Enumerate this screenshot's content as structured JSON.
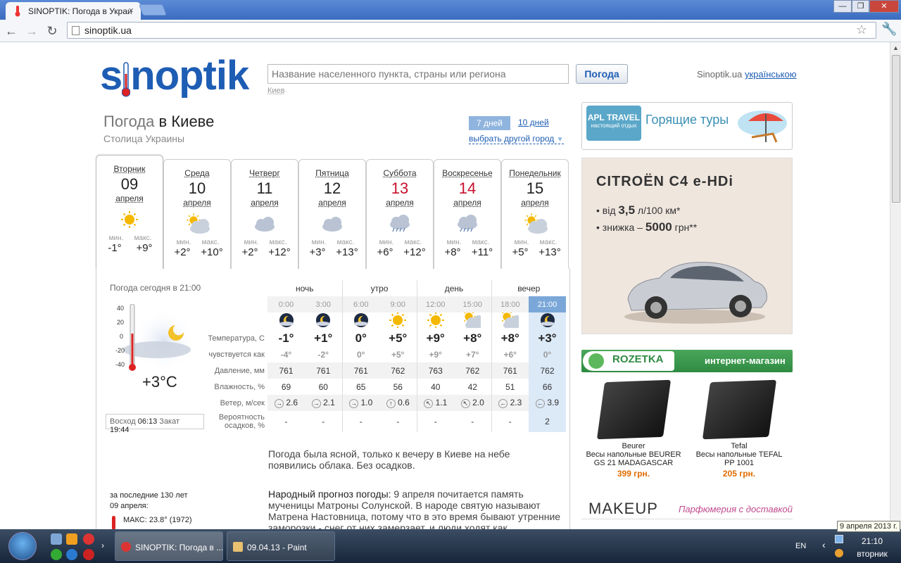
{
  "browser": {
    "tab_title": "SINOPTIK: Погода в Украи",
    "tab_close": "×",
    "url": "sinoptik.ua",
    "win_min": "—",
    "win_max": "❐",
    "win_close": "✕"
  },
  "header": {
    "logo": "sinoptik",
    "search_placeholder": "Название населенного пункта, страны или региона",
    "search_button": "Погода",
    "hint": "Киев",
    "lang_prefix": "Sinoptik.ua",
    "lang_link": "українською"
  },
  "city": {
    "prefix": "Погода",
    "name": "в Киеве",
    "subtitle": "Столица Украины",
    "btn_7": "7 дней",
    "btn_10": "10 дней",
    "other_city": "выбрать другой город"
  },
  "days": [
    {
      "name": "Вторник",
      "date": "09",
      "month": "апреля",
      "min_label": "мин.",
      "max_label": "макс.",
      "min": "-1°",
      "max": "+9°",
      "icon": "sun-icon"
    },
    {
      "name": "Среда",
      "date": "10",
      "month": "апреля",
      "min_label": "мин.",
      "max_label": "макс.",
      "min": "+2°",
      "max": "+10°",
      "icon": "cloud-sun-icon"
    },
    {
      "name": "Четверг",
      "date": "11",
      "month": "апреля",
      "min_label": "мин.",
      "max_label": "макс.",
      "min": "+2°",
      "max": "+12°",
      "icon": "cloud-icon"
    },
    {
      "name": "Пятница",
      "date": "12",
      "month": "апреля",
      "min_label": "мин.",
      "max_label": "макс.",
      "min": "+3°",
      "max": "+13°",
      "icon": "cloud-icon"
    },
    {
      "name": "Суббота",
      "date": "13",
      "month": "апреля",
      "min_label": "мин.",
      "max_label": "макс.",
      "min": "+6°",
      "max": "+12°",
      "icon": "rain-cloud-icon"
    },
    {
      "name": "Воскресенье",
      "date": "14",
      "month": "апреля",
      "min_label": "мин.",
      "max_label": "макс.",
      "min": "+8°",
      "max": "+11°",
      "icon": "rain-cloud-icon"
    },
    {
      "name": "Понедельник",
      "date": "15",
      "month": "апреля",
      "min_label": "мин.",
      "max_label": "макс.",
      "min": "+5°",
      "max": "+13°",
      "icon": "cloud-sun-icon"
    }
  ],
  "now": {
    "label": "Погода сегодня в 21:00",
    "temp": "+3°C",
    "scale": [
      "40",
      "20",
      "0",
      "-20",
      "-40"
    ],
    "sunrise_label": "Восход",
    "sunrise": "06:13",
    "sunset_label": "Закат",
    "sunset": "19:44"
  },
  "hourly": {
    "periods": [
      "ночь",
      "утро",
      "день",
      "вечер"
    ],
    "hours": [
      "0:00",
      "3:00",
      "6:00",
      "9:00",
      "12:00",
      "15:00",
      "18:00",
      "21:00"
    ],
    "icons": [
      "moon-cloud-icon",
      "moon-cloud-icon",
      "moon-cloud-icon",
      "sun-icon",
      "sun-icon",
      "sun-cloud-icon",
      "cloud-sun-icon",
      "moon-cloud-icon"
    ],
    "rows": [
      {
        "label": "Температура, С",
        "values": [
          "-1°",
          "+1°",
          "0°",
          "+5°",
          "+9°",
          "+8°",
          "+8°",
          "+3°"
        ]
      },
      {
        "label": "чувствуется как",
        "values": [
          "-4°",
          "-2°",
          "0°",
          "+5°",
          "+9°",
          "+7°",
          "+6°",
          "0°"
        ]
      },
      {
        "label": "Давление, мм",
        "values": [
          "761",
          "761",
          "761",
          "762",
          "763",
          "762",
          "761",
          "762"
        ]
      },
      {
        "label": "Влажность, %",
        "values": [
          "69",
          "60",
          "65",
          "56",
          "40",
          "42",
          "51",
          "66"
        ]
      },
      {
        "label": "Ветер, м/сек",
        "values": [
          "2.6",
          "2.1",
          "1.0",
          "0.6",
          "1.1",
          "2.0",
          "2.3",
          "3.9"
        ],
        "arrows": [
          "→",
          "→",
          "→",
          "↑",
          "↖",
          "↖",
          "←",
          "←"
        ]
      },
      {
        "label": "Вероятность осадков, %",
        "values": [
          "-",
          "-",
          "-",
          "-",
          "-",
          "-",
          "-",
          "2"
        ]
      }
    ]
  },
  "description": "Погода была ясной, только к вечеру в Киеве на небе появились облака. Без осадков.",
  "folk": {
    "title": "Народный прогноз погоды:",
    "text": " 9 апреля почитается память мученицы Матроны Солунской. В народе святую называют Матрена Настовница, потому что в это время бывают утренние заморозки - снег от них замерзает, и люди ходят как"
  },
  "history": {
    "title": "за последние 130 лет",
    "date": "09 апреля:",
    "max_label": "МАКС:",
    "max": "23.8°",
    "max_year": "(1972)"
  },
  "ads": {
    "tours_logo": "APL TRAVEL",
    "tours_sub": "настоящий отдых",
    "tours_text": "Горящие туры",
    "citroen_title": "CITROËN C4 e-HDi",
    "citroen_l1_pre": "• від ",
    "citroen_l1_val": "3,5",
    "citroen_l1_post": " л/100 км*",
    "citroen_l2_pre": "• знижка – ",
    "citroen_l2_val": "5000",
    "citroen_l2_post": " грн**",
    "rozetka": "ROZETKA",
    "rozetka_sub": "интернет-магазин",
    "products": [
      {
        "brand": "Beurer",
        "name": "Весы напольные BEURER GS 21 MADAGASCAR",
        "price": "399 грн."
      },
      {
        "brand": "Tefal",
        "name": "Весы напольные TEFAL PP 1001",
        "price": "205 грн."
      }
    ],
    "makeup": "MAKEUP",
    "makeup_sub": "Парфюмерия с доставкой"
  },
  "taskbar": {
    "task1": "SINOPTIK: Погода в ...",
    "task2": "09.04.13 - Paint",
    "lang": "EN",
    "time": "21:10",
    "weekday": "вторник",
    "tooltip": "9 апреля 2013 г."
  },
  "colors": {
    "brand": "#1e5db4",
    "red": "#c8102e",
    "price": "#e06c00"
  }
}
